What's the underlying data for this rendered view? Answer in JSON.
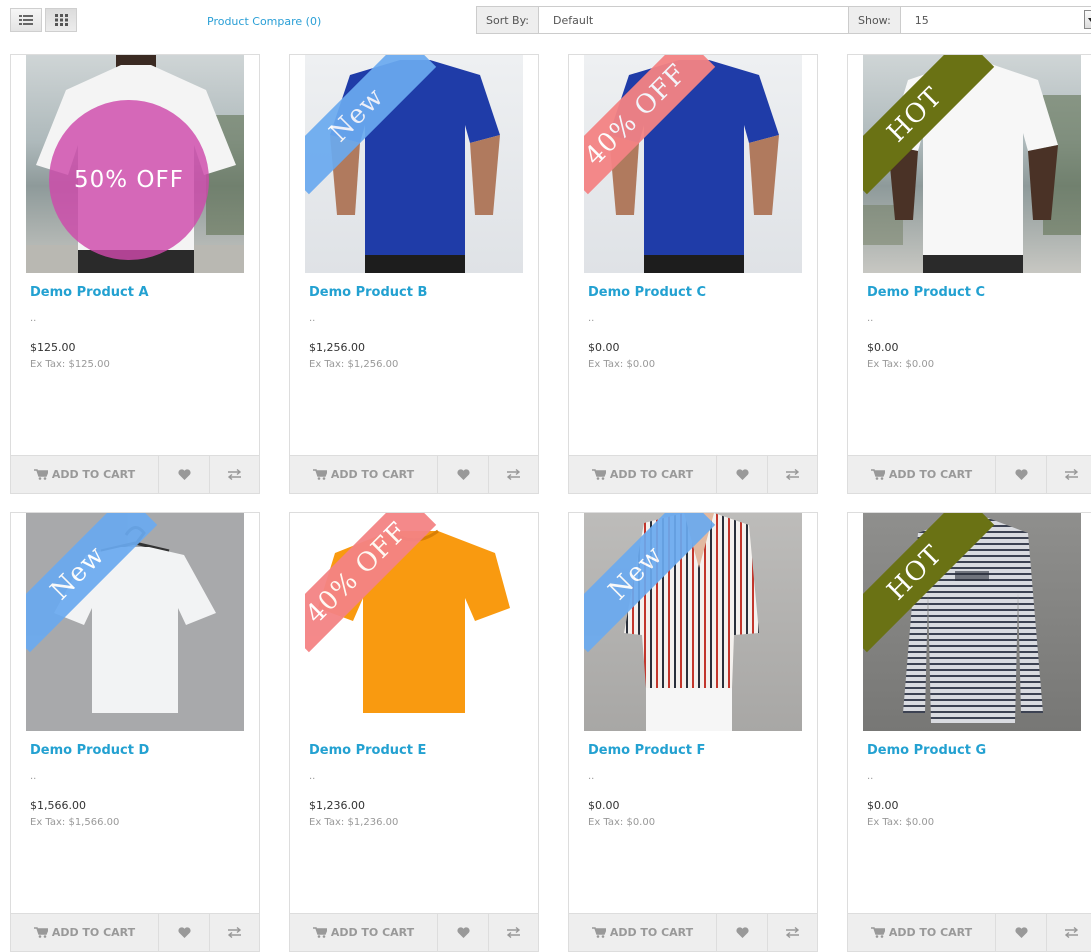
{
  "toolbar": {
    "compare_label": "Product Compare (0)",
    "sort": {
      "label": "Sort By:",
      "value": "Default"
    },
    "show": {
      "label": "Show:",
      "value": "15"
    }
  },
  "ui": {
    "cart_label": "ADD TO CART"
  },
  "colors": {
    "link": "#23a1d1",
    "badge_new": "#6aaaf0",
    "badge_sale": "#f48384",
    "badge_hot": "#6a7214",
    "badge_circle": "#ce49ab"
  },
  "products": [
    {
      "name": "Demo Product A",
      "description": "..",
      "price": "$125.00",
      "ex_tax": "Ex Tax: $125.00",
      "badge": "50% OFF",
      "badge_type": "circle",
      "image": "pink-tshirt-man"
    },
    {
      "name": "Demo Product B",
      "description": "..",
      "price": "$1,256.00",
      "ex_tax": "Ex Tax: $1,256.00",
      "badge": "New",
      "badge_type": "new",
      "image": "blue-tshirt-man"
    },
    {
      "name": "Demo Product C",
      "description": "..",
      "price": "$0.00",
      "ex_tax": "Ex Tax: $0.00",
      "badge": "40% OFF",
      "badge_type": "sale",
      "image": "blue-tshirt-man"
    },
    {
      "name": "Demo Product C",
      "description": "..",
      "price": "$0.00",
      "ex_tax": "Ex Tax: $0.00",
      "badge": "HOT",
      "badge_type": "hot",
      "image": "white-tshirt-man"
    },
    {
      "name": "Demo Product D",
      "description": "..",
      "price": "$1,566.00",
      "ex_tax": "Ex Tax: $1,566.00",
      "badge": "New",
      "badge_type": "new",
      "image": "white-tshirt-hanger"
    },
    {
      "name": "Demo Product E",
      "description": "..",
      "price": "$1,236.00",
      "ex_tax": "Ex Tax: $1,236.00",
      "badge": "40% OFF",
      "badge_type": "sale",
      "image": "orange-tshirt"
    },
    {
      "name": "Demo Product F",
      "description": "..",
      "price": "$0.00",
      "ex_tax": "Ex Tax: $0.00",
      "badge": "New",
      "badge_type": "new",
      "image": "striped-blouse-woman"
    },
    {
      "name": "Demo Product G",
      "description": "..",
      "price": "$0.00",
      "ex_tax": "Ex Tax: $0.00",
      "badge": "HOT",
      "badge_type": "hot",
      "image": "striped-longsleeve-man"
    }
  ]
}
